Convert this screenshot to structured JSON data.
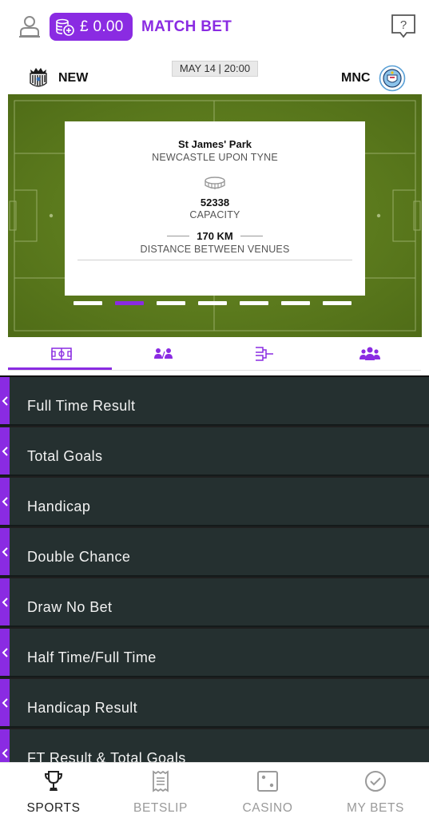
{
  "header": {
    "balance": "£ 0.00",
    "title": "MATCH BET",
    "icons": {
      "user": "user-icon",
      "coins": "coins-icon",
      "help": "help-chat-icon"
    }
  },
  "match": {
    "home": {
      "name": "NEW",
      "crest": "newcastle-crest-icon"
    },
    "away": {
      "name": "MNC",
      "crest": "man-city-crest-icon"
    },
    "datetime": "MAY 14 | 20:00"
  },
  "venue": {
    "name": "St James' Park",
    "city": "NEWCASTLE UPON TYNE",
    "capacity": "52338",
    "capacity_label": "CAPACITY",
    "distance": "170 KM",
    "distance_label": "DISTANCE BETWEEN VENUES",
    "slides_total": 7,
    "slide_active_index": 1
  },
  "tabs": [
    {
      "name": "pitch",
      "icon": "pitch-icon",
      "active": true
    },
    {
      "name": "head-to-head",
      "icon": "players-versus-icon",
      "active": false
    },
    {
      "name": "bracket",
      "icon": "bracket-icon",
      "active": false
    },
    {
      "name": "team",
      "icon": "group-icon",
      "active": false
    }
  ],
  "markets": [
    {
      "label": "Full Time Result"
    },
    {
      "label": "Total Goals"
    },
    {
      "label": "Handicap"
    },
    {
      "label": "Double Chance"
    },
    {
      "label": "Draw No Bet"
    },
    {
      "label": "Half Time/Full Time"
    },
    {
      "label": "Handicap Result"
    },
    {
      "label": "FT Result & Total Goals"
    }
  ],
  "bottom_nav": [
    {
      "label": "SPORTS",
      "icon": "trophy-icon",
      "active": true
    },
    {
      "label": "BETSLIP",
      "icon": "receipt-icon",
      "active": false
    },
    {
      "label": "CASINO",
      "icon": "dice-icon",
      "active": false
    },
    {
      "label": "MY BETS",
      "icon": "check-circle-icon",
      "active": false
    }
  ],
  "colors": {
    "accent": "#8a2be2",
    "pitch": "#59781c",
    "market_row": "#253030",
    "nav_inactive": "#9a9a9a"
  }
}
